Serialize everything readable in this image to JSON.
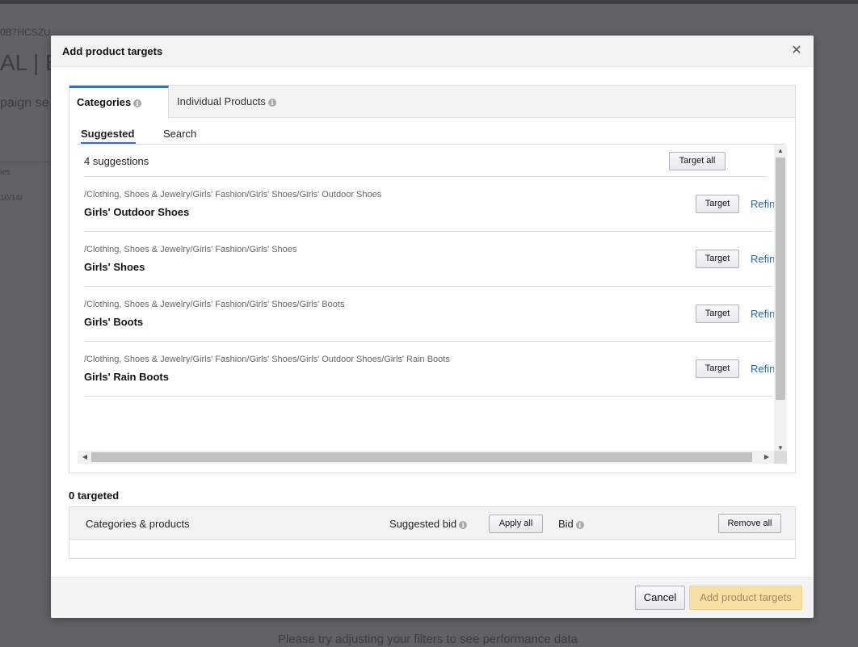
{
  "background": {
    "asin": "0B7HCSZU",
    "title": "AL | E",
    "subtitle": "paign se",
    "small1": "ies",
    "small2": "10/14/",
    "empty_message": "Please try adjusting your filters to see performance data"
  },
  "modal": {
    "title": "Add product targets",
    "close_icon": "close-icon"
  },
  "tabs": [
    {
      "label": "Categories",
      "active": true
    },
    {
      "label": "Individual Products",
      "active": false
    }
  ],
  "subtabs": [
    {
      "label": "Suggested",
      "active": true
    },
    {
      "label": "Search",
      "active": false
    }
  ],
  "suggestions": {
    "count_label": "4 suggestions",
    "target_all_label": "Target all",
    "target_label": "Target",
    "refine_label": "Refin",
    "items": [
      {
        "path": "/Clothing, Shoes & Jewelry/Girls' Fashion/Girls' Shoes/Girls' Outdoor Shoes",
        "name": "Girls' Outdoor Shoes"
      },
      {
        "path": "/Clothing, Shoes & Jewelry/Girls' Fashion/Girls' Shoes",
        "name": "Girls' Shoes"
      },
      {
        "path": "/Clothing, Shoes & Jewelry/Girls' Fashion/Girls' Shoes/Girls' Boots",
        "name": "Girls' Boots"
      },
      {
        "path": "/Clothing, Shoes & Jewelry/Girls' Fashion/Girls' Shoes/Girls' Outdoor Shoes/Girls' Rain Boots",
        "name": "Girls' Rain Boots"
      }
    ]
  },
  "targeted": {
    "label": "0 targeted",
    "col_categories": "Categories & products",
    "col_suggested_bid": "Suggested bid",
    "apply_all_label": "Apply all",
    "col_bid": "Bid",
    "remove_all_label": "Remove all"
  },
  "footer": {
    "cancel_label": "Cancel",
    "add_label": "Add product targets"
  },
  "colors": {
    "accent_tab": "#3b6fb5",
    "link": "#2a67a8",
    "primary_disabled": "#f7dfa5"
  }
}
